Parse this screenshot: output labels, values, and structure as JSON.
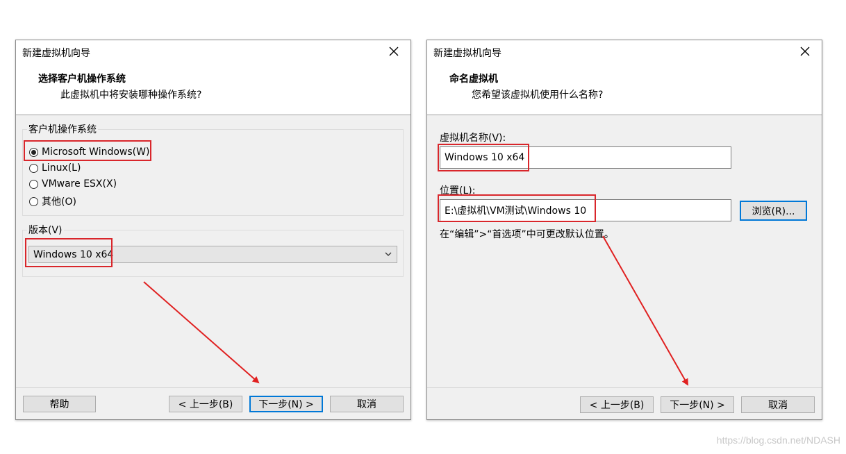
{
  "left_dialog": {
    "title": "新建虚拟机向导",
    "heading": "选择客户机操作系统",
    "subheading": "此虚拟机中将安装哪种操作系统?",
    "os_group_label": "客户机操作系统",
    "os_options": [
      {
        "label": "Microsoft Windows(W)",
        "selected": true
      },
      {
        "label": "Linux(L)",
        "selected": false
      },
      {
        "label": "VMware ESX(X)",
        "selected": false
      },
      {
        "label": "其他(O)",
        "selected": false
      }
    ],
    "version_label": "版本(V)",
    "version_value": "Windows 10 x64",
    "buttons": {
      "help": "帮助",
      "back": "< 上一步(B)",
      "next": "下一步(N) >",
      "cancel": "取消"
    }
  },
  "right_dialog": {
    "title": "新建虚拟机向导",
    "heading": "命名虚拟机",
    "subheading": "您希望该虚拟机使用什么名称?",
    "name_label": "虚拟机名称(V):",
    "name_value": "Windows 10 x64",
    "location_label": "位置(L):",
    "location_value": "E:\\虚拟机\\VM测试\\Windows 10",
    "browse_button": "浏览(R)...",
    "hint": "在“编辑”>“首选项”中可更改默认位置。",
    "buttons": {
      "back": "< 上一步(B)",
      "next": "下一步(N) >",
      "cancel": "取消"
    }
  },
  "watermark": "https://blog.csdn.net/NDASH",
  "colors": {
    "highlight_red": "#d9262b",
    "default_button_blue": "#0078d7",
    "dialog_bg": "#f0f0f0"
  },
  "icons": {
    "close": "close-icon",
    "dropdown": "chevron-down-icon"
  }
}
